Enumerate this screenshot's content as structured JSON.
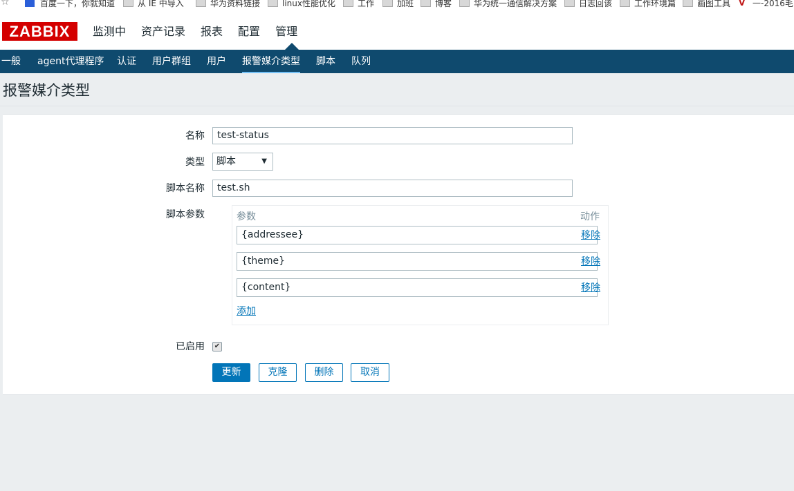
{
  "bookmarks": {
    "items": [
      {
        "label": "百度一下，你就知道",
        "icon": "paw-icon"
      },
      {
        "label": "从 IE 中导入",
        "icon": "folder-icon"
      },
      {
        "label": "华为资料链接",
        "icon": "folder-icon"
      },
      {
        "label": "linux性能优化",
        "icon": "folder-icon"
      },
      {
        "label": "工作",
        "icon": "folder-icon"
      },
      {
        "label": "加班",
        "icon": "folder-icon"
      },
      {
        "label": "博客",
        "icon": "folder-icon"
      },
      {
        "label": "华为统一通信解决方案",
        "icon": "folder-icon"
      },
      {
        "label": "日志回该",
        "icon": "folder-icon"
      },
      {
        "label": "工作环境篇",
        "icon": "folder-icon"
      },
      {
        "label": "画图工具",
        "icon": "folder-icon"
      },
      {
        "label": "一-2016毛",
        "icon": "v-logo-icon"
      }
    ]
  },
  "header": {
    "logo": "ZABBIX",
    "nav": [
      "监测中",
      "资产记录",
      "报表",
      "配置",
      "管理"
    ],
    "active_nav": "管理"
  },
  "subnav": {
    "items": [
      "一般",
      "agent代理程序",
      "认证",
      "用户群组",
      "用户",
      "报警媒介类型",
      "脚本",
      "队列"
    ],
    "active": "报警媒介类型"
  },
  "page": {
    "title": "报警媒介类型"
  },
  "form": {
    "name_label": "名称",
    "name_value": "test-status",
    "type_label": "类型",
    "type_value": "脚本",
    "script_name_label": "脚本名称",
    "script_name_value": "test.sh",
    "script_params_label": "脚本参数",
    "params_header": "参数",
    "action_header": "动作",
    "params": [
      {
        "value": "{addressee}",
        "remove": "移除"
      },
      {
        "value": "{theme}",
        "remove": "移除"
      },
      {
        "value": "{content}",
        "remove": "移除"
      }
    ],
    "add_link": "添加",
    "enabled_label": "已启用",
    "enabled": true,
    "buttons": {
      "update": "更新",
      "clone": "克隆",
      "delete": "删除",
      "cancel": "取消"
    }
  },
  "colors": {
    "brand": "#d40000",
    "subnav_bg": "#0f4a6e",
    "link": "#0275b8",
    "page_bg": "#ebeef0"
  }
}
